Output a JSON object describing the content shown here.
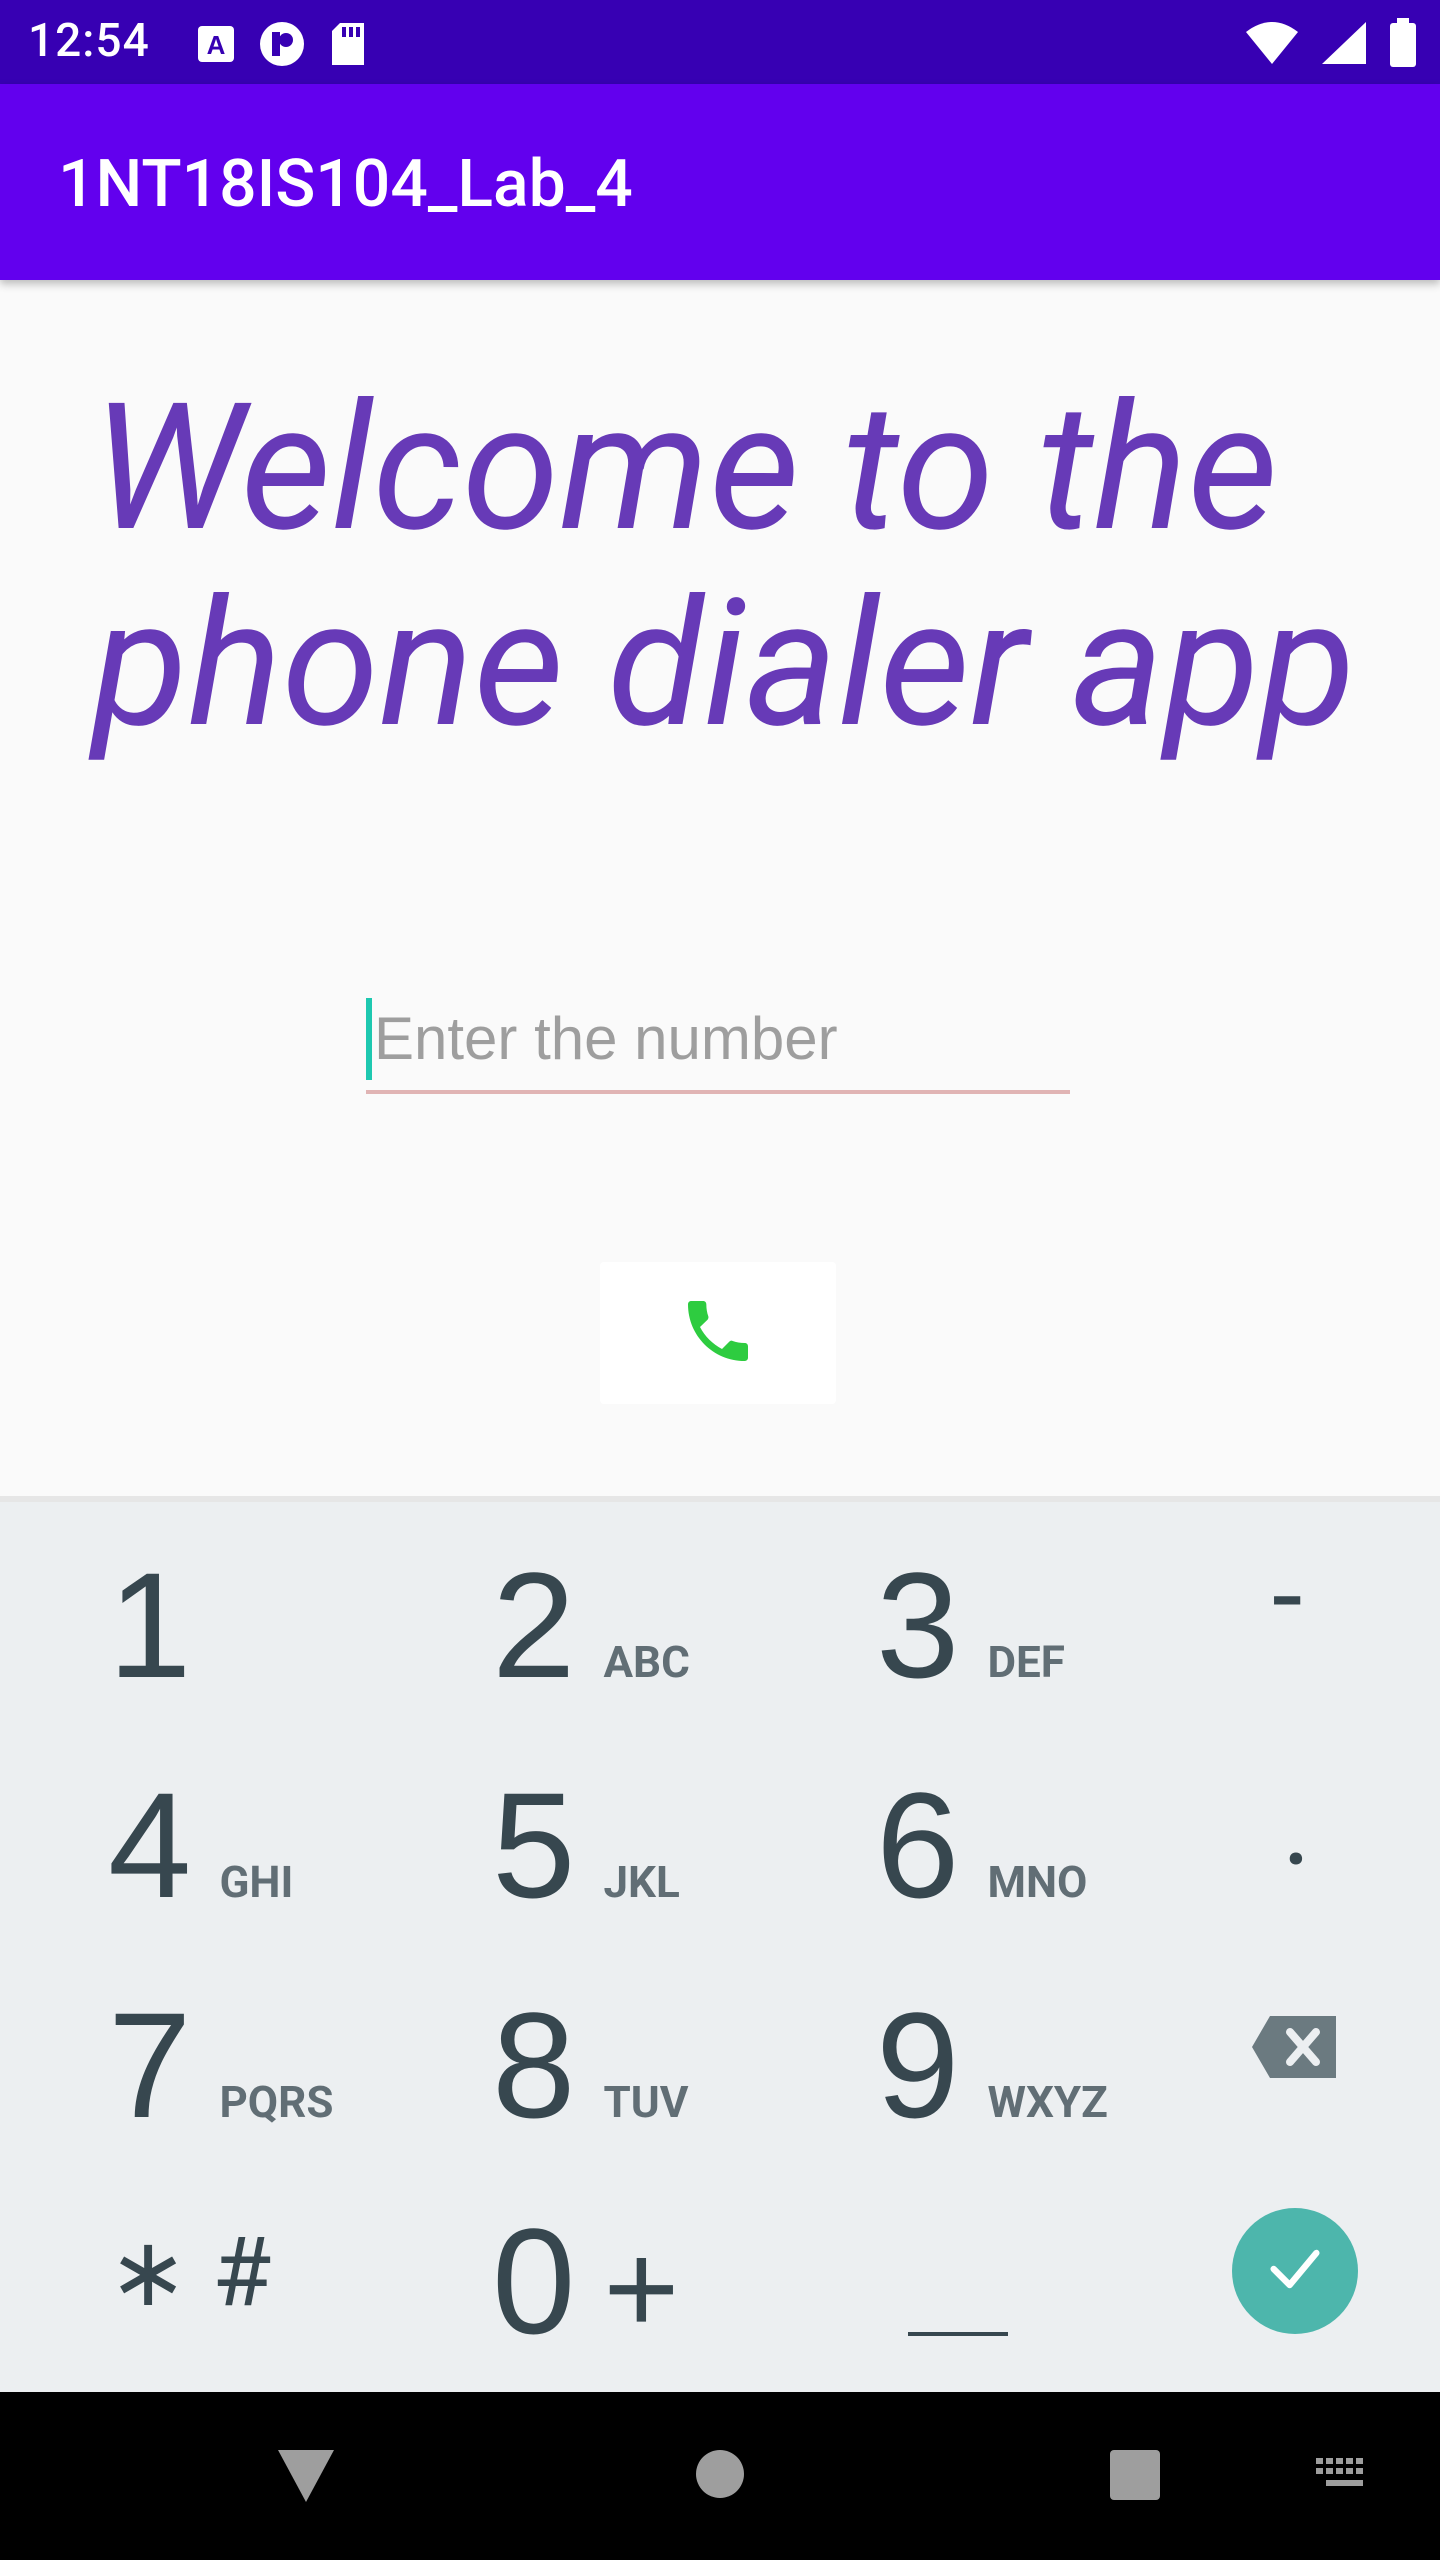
{
  "status_bar": {
    "time": "12:54",
    "left_icons": [
      "a-box-icon",
      "p-circle-icon",
      "sd-card-icon"
    ],
    "right_icons": [
      "wifi-icon",
      "signal-icon",
      "battery-icon"
    ]
  },
  "app_bar": {
    "title": "1NT18IS104_Lab_4"
  },
  "main": {
    "welcome": "Welcome to  the phone dialer app",
    "number_input": {
      "value": "",
      "placeholder": "Enter the number"
    },
    "call_button_icon": "phone-icon"
  },
  "keyboard": {
    "keys": [
      {
        "digit": "1",
        "letters": ""
      },
      {
        "digit": "2",
        "letters": "ABC"
      },
      {
        "digit": "3",
        "letters": "DEF"
      },
      {
        "digit": "4",
        "letters": "GHI"
      },
      {
        "digit": "5",
        "letters": "JKL"
      },
      {
        "digit": "6",
        "letters": "MNO"
      },
      {
        "digit": "7",
        "letters": "PQRS"
      },
      {
        "digit": "8",
        "letters": "TUV"
      },
      {
        "digit": "9",
        "letters": "WXYZ"
      },
      {
        "digit": "0",
        "letters": "+"
      }
    ],
    "dash": "-",
    "dot": ".",
    "star_hash": "∗ #",
    "space": "___"
  },
  "colors": {
    "status_bar": "#3700b3",
    "app_bar": "#6200ee",
    "welcome_text": "#673ab7",
    "call_icon": "#2ecc40",
    "done_button": "#4db6ac"
  }
}
